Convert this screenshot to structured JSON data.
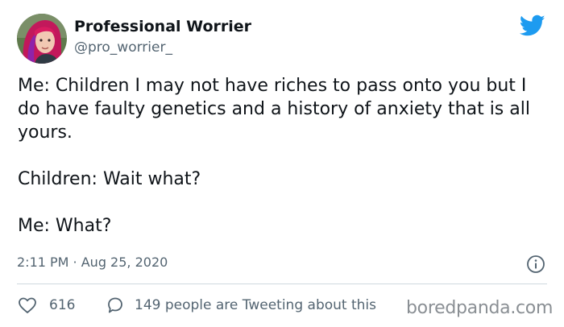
{
  "user": {
    "display_name": "Professional Worrier",
    "handle": "@pro_worrier_"
  },
  "tweet": {
    "lines": [
      "Me: Children I may not have riches to pass onto you but I do have faulty genetics and a history of anxiety that is all yours.",
      "Children: Wait what?",
      "Me: What?"
    ],
    "timestamp": "2:11 PM · Aug 25, 2020"
  },
  "stats": {
    "likes": "616",
    "tweeting_about": "149 people are Tweeting about this"
  },
  "watermark": "boredpanda.com",
  "colors": {
    "twitter_blue": "#1d9bf0",
    "secondary_text": "#536471",
    "avatar_hair": "#d9266f"
  },
  "icons": [
    "twitter-bird-icon",
    "info-icon",
    "heart-icon",
    "speech-bubble-icon"
  ]
}
